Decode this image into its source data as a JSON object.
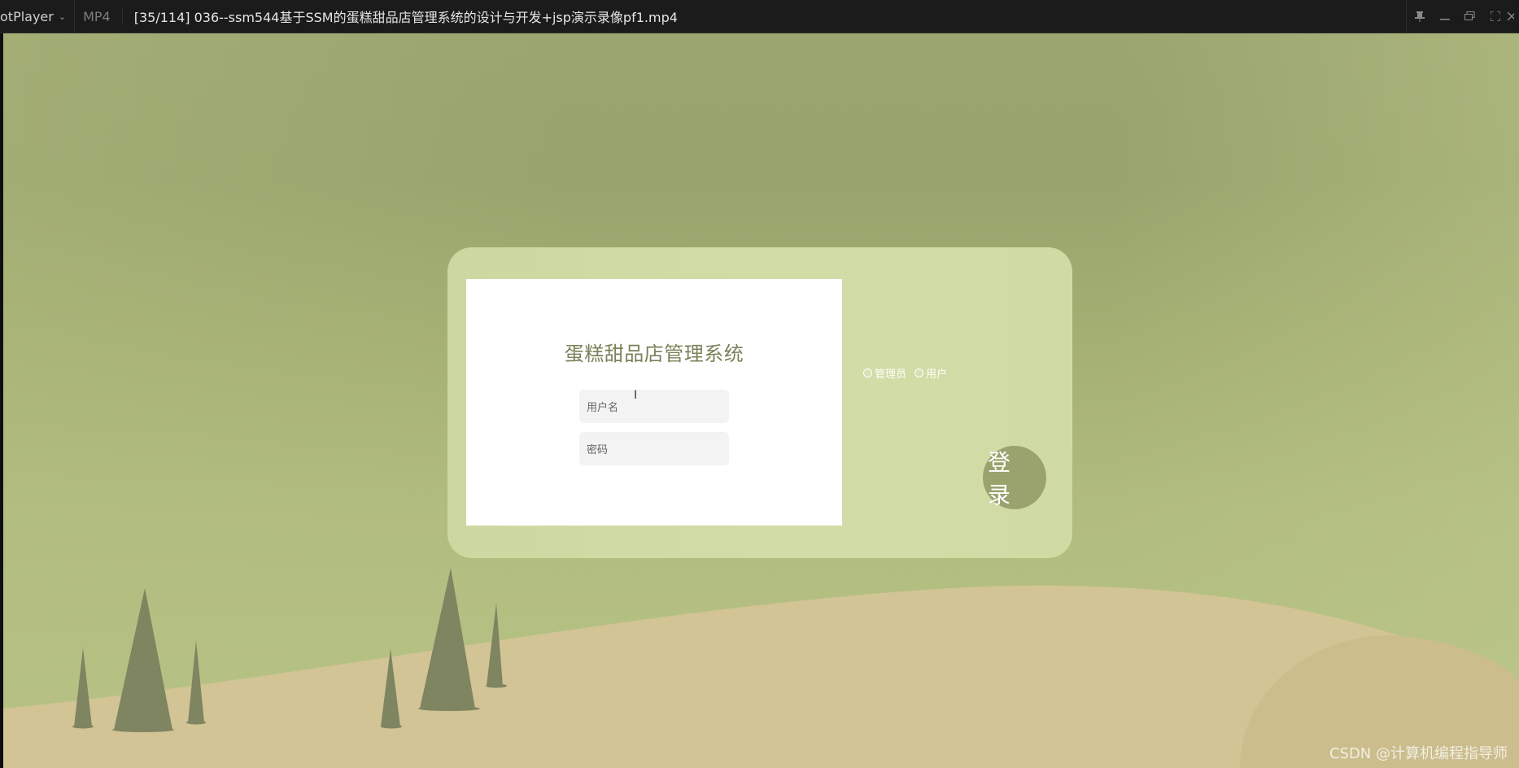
{
  "player": {
    "app_name": "otPlayer",
    "format": "MP4",
    "file_title": "[35/114] 036--ssm544基于SSM的蛋糕甜品店管理系统的设计与开发+jsp演示录像pf1.mp4"
  },
  "login": {
    "system_title": "蛋糕甜品店管理系统",
    "username_placeholder": "用户名",
    "password_placeholder": "密码",
    "roles": [
      {
        "label": "管理员",
        "selected": false
      },
      {
        "label": "用户",
        "selected": false
      }
    ],
    "login_button": "登 录"
  },
  "watermark": "CSDN @计算机编程指导师",
  "colors": {
    "background_sky": "#9aa56f",
    "card": "#d0dba4",
    "login_button": "#9aa26d",
    "title_text": "#7b8159",
    "hill": "#d2c495",
    "tree": "#7f8461"
  }
}
